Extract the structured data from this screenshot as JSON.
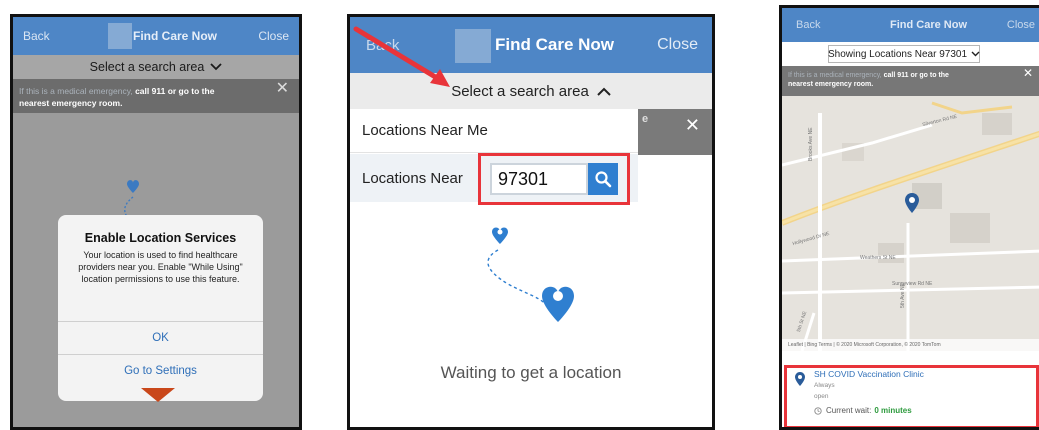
{
  "panel1": {
    "nav": {
      "back": "Back",
      "title": "Find Care Now",
      "close": "Close"
    },
    "selector": {
      "label": "Select a search area",
      "chevron": "chevron-down"
    },
    "banner": {
      "lead": "If this is a medical emergency,",
      "emph": "call 911 or go to the",
      "line2": "nearest emergency room.",
      "close": "✕"
    },
    "dialog": {
      "title": "Enable Location Services",
      "body": "Your location is used to find healthcare providers near you. Enable \"While Using\" location permissions to use this feature.",
      "ok": "OK",
      "settings": "Go to Settings"
    }
  },
  "panel2": {
    "nav": {
      "back": "Back",
      "title": "Find Care Now",
      "close": "Close"
    },
    "selector": {
      "label": "Select a search area",
      "chevron": "chevron-up"
    },
    "menu": {
      "near_me": "Locations Near Me",
      "near": "Locations Near",
      "zip_value": "97301"
    },
    "banner_fragment": "e",
    "close": "✕",
    "waiting": "Waiting to get a location"
  },
  "panel3": {
    "nav": {
      "back": "Back",
      "title": "Find Care Now",
      "close": "Close"
    },
    "selector": {
      "label": "Showing Locations Near 97301",
      "chevron": "chevron-down"
    },
    "banner": {
      "lead": "If this is a medical emergency,",
      "emph": "call 911 or go to the",
      "line2": "nearest emergency room.",
      "close": "✕"
    },
    "map": {
      "streets": [
        "Brooks Ave NE",
        "Silverton Rd NE",
        "Weathers St NE",
        "Sunnyview Rd NE",
        "Hollywood Dr NE",
        "5th Ave NE",
        "5th St NE"
      ],
      "attribution": "Leaflet | Bing Terms | © 2020 Microsoft Corporation, © 2020 TomTom"
    },
    "result": {
      "name": "SH COVID Vaccination Clinic",
      "hours": "Always",
      "status": "open",
      "wait_label": "Current wait:",
      "wait_value": "0 minutes"
    }
  },
  "colors": {
    "nav_blue": "#4e86c6",
    "highlight_red": "#e8343a",
    "pin_blue": "#2f7fd0",
    "wait_green": "#2e9b3e"
  }
}
